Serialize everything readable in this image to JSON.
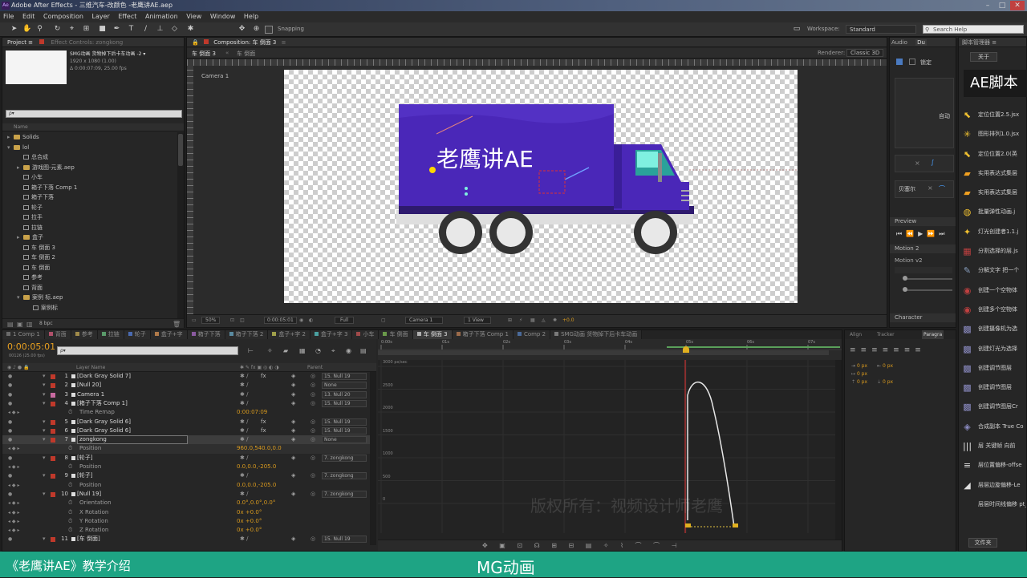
{
  "window": {
    "title": "Adobe After Effects - 三维汽车-改颜色 -老鹰讲AE.aep",
    "min": "–",
    "max": "□",
    "close": "✕"
  },
  "menu": [
    "File",
    "Edit",
    "Composition",
    "Layer",
    "Effect",
    "Animation",
    "View",
    "Window",
    "Help"
  ],
  "toolbar": {
    "snapping": "Snapping",
    "workspace_label": "Workspace:",
    "workspace_value": "Standard",
    "search_placeholder": "Search Help"
  },
  "project": {
    "tab_project": "Project ≡",
    "tab_effect": "Effect Controls: zongkong",
    "comp_name": "SMG动画 货物掉下后卡车动画 -2 ▾",
    "comp_size": "1920 x 1080 (1.00)",
    "comp_duration": "Δ 0:00:07:09, 25.00 fps",
    "search_placeholder": "ρ▾",
    "col_name": "Name",
    "items": [
      {
        "t": "folder",
        "n": "Solids",
        "d": 0,
        "arrow": "▸"
      },
      {
        "t": "folder",
        "n": "lol",
        "d": 0,
        "arrow": "▾"
      },
      {
        "t": "comp",
        "n": "总合成",
        "d": 1,
        "arrow": ""
      },
      {
        "t": "folder",
        "n": "游戏图-元素.aep",
        "d": 1,
        "arrow": "▸"
      },
      {
        "t": "comp",
        "n": "小车",
        "d": 1,
        "arrow": ""
      },
      {
        "t": "comp",
        "n": "箱子下落 Comp 1",
        "d": 1,
        "arrow": ""
      },
      {
        "t": "comp",
        "n": "箱子下落",
        "d": 1,
        "arrow": ""
      },
      {
        "t": "comp",
        "n": "轮子",
        "d": 1,
        "arrow": ""
      },
      {
        "t": "comp",
        "n": "拉手",
        "d": 1,
        "arrow": ""
      },
      {
        "t": "comp",
        "n": "拉链",
        "d": 1,
        "arrow": ""
      },
      {
        "t": "folder",
        "n": "盒子",
        "d": 1,
        "arrow": "▸"
      },
      {
        "t": "comp",
        "n": "车 倒面 3",
        "d": 1,
        "arrow": ""
      },
      {
        "t": "comp",
        "n": "车 倒面 2",
        "d": 1,
        "arrow": ""
      },
      {
        "t": "comp",
        "n": "车 倒面",
        "d": 1,
        "arrow": ""
      },
      {
        "t": "comp",
        "n": "参考",
        "d": 1,
        "arrow": ""
      },
      {
        "t": "comp",
        "n": "背面",
        "d": 1,
        "arrow": ""
      },
      {
        "t": "folder",
        "n": "案例 标.aep",
        "d": 1,
        "arrow": "▾"
      },
      {
        "t": "comp",
        "n": "案例标",
        "d": 2,
        "arrow": ""
      }
    ],
    "bpc": "8 bpc"
  },
  "composition": {
    "tab": "Composition: 车 倒面 3",
    "subtabs": [
      "车 倒面 3",
      "车 倒面"
    ],
    "renderer_label": "Renderer:",
    "renderer_value": "Classic 3D",
    "camera_label": "Camera 1",
    "truck_text": "老鹰讲AE",
    "footer": {
      "zoom": "50%",
      "time": "0:00:05:01",
      "res": "Full",
      "view": "Camera 1",
      "views": "1 View",
      "exposure": "+0.0"
    }
  },
  "timeline": {
    "tabs": [
      {
        "label": "1 Comp 1",
        "active": false,
        "color": "#6a6a6a"
      },
      {
        "label": "背面",
        "active": false,
        "color": "#b0506a"
      },
      {
        "label": "参考",
        "active": false,
        "color": "#a08a4a"
      },
      {
        "label": "拉链",
        "active": false,
        "color": "#5a9a6a"
      },
      {
        "label": "轮子",
        "active": false,
        "color": "#4a6ab0"
      },
      {
        "label": "盒子+字",
        "active": false,
        "color": "#b07a4a"
      },
      {
        "label": "箱子下落",
        "active": false,
        "color": "#8a5aa0"
      },
      {
        "label": "箱子下落 2",
        "active": false,
        "color": "#5a8aa0"
      },
      {
        "label": "盒子+字 2",
        "active": false,
        "color": "#a0a04a"
      },
      {
        "label": "盒子+字 3",
        "active": false,
        "color": "#4aa0a0"
      },
      {
        "label": "小车",
        "active": false,
        "color": "#a04a4a"
      },
      {
        "label": "车 倒面",
        "active": false,
        "color": "#6a9a4a"
      },
      {
        "label": "车 倒面 3",
        "active": true,
        "color": "#b0b0b0"
      },
      {
        "label": "箱子下落 Comp 1",
        "active": false,
        "color": "#9a6a4a"
      },
      {
        "label": "Comp 2",
        "active": false,
        "color": "#4a6a9a"
      },
      {
        "label": "SMG动画 货物掉下后卡车动画",
        "active": false,
        "color": "#7a7a7a"
      }
    ],
    "timecode": "0:00:05:01",
    "timecode_sub": "00126 (25.00 fps)",
    "search_placeholder": "ρ▾",
    "col_layer": "Layer Name",
    "col_parent": "Parent",
    "layers": [
      {
        "num": "1",
        "name": "[Dark Gray Solid 7]",
        "color": "#c0392b",
        "parent": "15. Null 19",
        "type": "layer",
        "sw": "fx"
      },
      {
        "num": "2",
        "name": "[Null 20]",
        "color": "#c0392b",
        "parent": "None",
        "type": "layer",
        "sw": ""
      },
      {
        "num": "3",
        "name": "Camera 1",
        "color": "#c86aa0",
        "parent": "13. Null 20",
        "type": "layer",
        "sw": ""
      },
      {
        "num": "4",
        "name": "[箱子下落 Comp 1]",
        "color": "#c0392b",
        "parent": "15. Null 19",
        "type": "layer",
        "sw": ""
      },
      {
        "num": "",
        "name": "Time Remap",
        "color": "",
        "val": "0:00:07:09",
        "type": "prop"
      },
      {
        "num": "5",
        "name": "[Dark Gray Solid 6]",
        "color": "#c0392b",
        "parent": "15. Null 19",
        "type": "layer",
        "sw": "fx"
      },
      {
        "num": "6",
        "name": "[Dark Gray Solid 6]",
        "color": "#c0392b",
        "parent": "15. Null 19",
        "type": "layer",
        "sw": "fx"
      },
      {
        "num": "7",
        "name": "zongkong",
        "color": "#c0392b",
        "parent": "None",
        "type": "layer",
        "sw": "",
        "selected": true
      },
      {
        "num": "",
        "name": "Position",
        "color": "",
        "val": "960.0,540.0,0.0",
        "type": "prop",
        "hl": true
      },
      {
        "num": "8",
        "name": "[轮子]",
        "color": "#c0392b",
        "parent": "7. zongkong",
        "type": "layer",
        "sw": ""
      },
      {
        "num": "",
        "name": "Position",
        "color": "",
        "val": "0.0,0.0,-205.0",
        "type": "prop"
      },
      {
        "num": "9",
        "name": "[轮子]",
        "color": "#c0392b",
        "parent": "7. zongkong",
        "type": "layer",
        "sw": ""
      },
      {
        "num": "",
        "name": "Position",
        "color": "",
        "val": "0.0,0.0,-205.0",
        "type": "prop"
      },
      {
        "num": "10",
        "name": "[Null 19]",
        "color": "#c0392b",
        "parent": "7. zongkong",
        "type": "layer",
        "sw": ""
      },
      {
        "num": "",
        "name": "Orientation",
        "color": "",
        "val": "0.0°,0.0°,0.0°",
        "type": "prop"
      },
      {
        "num": "",
        "name": "X Rotation",
        "color": "",
        "val": "0x +0.0°",
        "type": "prop"
      },
      {
        "num": "",
        "name": "Y Rotation",
        "color": "",
        "val": "0x +0.0°",
        "type": "prop"
      },
      {
        "num": "",
        "name": "Z Rotation",
        "color": "",
        "val": "0x +0.0°",
        "type": "prop"
      },
      {
        "num": "11",
        "name": "[车 倒面]",
        "color": "#c0392b",
        "parent": "15. Null 19",
        "type": "layer",
        "sw": ""
      }
    ],
    "ruler": [
      "0:00s",
      "01s",
      "02s",
      "03s",
      "04s",
      "05s",
      "06s",
      "07s"
    ],
    "graph_labels": [
      "3000 px/sec",
      "2500",
      "2000",
      "1500",
      "1000",
      "500",
      "0"
    ],
    "watermark": "版权所有：视频设计师老鹰"
  },
  "right": {
    "tabs1": [
      "Audio",
      "Du"
    ],
    "align_label": "锁定",
    "auto_label": "自动",
    "bezier_label": "贝塞尔",
    "preview_tab": "Preview",
    "motion2_tab": "Motion 2",
    "motion_v2": "Motion v2",
    "character_tab": "Character",
    "align_tabs": [
      "Align",
      "Tracker",
      "Paragra"
    ],
    "para_values": [
      "0 px",
      "0 px",
      "0 px",
      "0 px",
      "0 px"
    ]
  },
  "scripts": {
    "tab": "脚本管理器 ≡",
    "close_btn": "关于",
    "banner": "AE脚本",
    "items": [
      {
        "i": "⬉",
        "c": "#f0c030",
        "n": "定位位置2.5.jsx"
      },
      {
        "i": "✳",
        "c": "#f0c030",
        "n": "图形排列1.0.jsx"
      },
      {
        "i": "⬉",
        "c": "#f0c030",
        "n": "定位位置2.0(英"
      },
      {
        "i": "▰",
        "c": "#f0a020",
        "n": "实用表达式集层"
      },
      {
        "i": "▰",
        "c": "#f0a020",
        "n": "实用表达式集层"
      },
      {
        "i": "◍",
        "c": "#f0c030",
        "n": "批量弹性动画.j"
      },
      {
        "i": "✦",
        "c": "#f0c030",
        "n": "灯光创建者1.1.j"
      },
      {
        "i": "▦",
        "c": "#c04040",
        "n": "分割选择的层.js"
      },
      {
        "i": "✎",
        "c": "#8aa0c0",
        "n": "分解文字 把一个"
      },
      {
        "i": "◉",
        "c": "#c04040",
        "n": "创建一个空物体"
      },
      {
        "i": "◉",
        "c": "#c04040",
        "n": "创建多个空物体"
      },
      {
        "i": "▩",
        "c": "#8a8ac0",
        "n": "创建摄像机为选"
      },
      {
        "i": "▩",
        "c": "#8a8ac0",
        "n": "创建灯光为选择"
      },
      {
        "i": "▩",
        "c": "#8a8ac0",
        "n": "创建调节图层"
      },
      {
        "i": "▩",
        "c": "#8a8ac0",
        "n": "创建调节图层"
      },
      {
        "i": "▩",
        "c": "#8a8ac0",
        "n": "创建调节图层Cr"
      },
      {
        "i": "◈",
        "c": "#8a8ac0",
        "n": "合成副本 True Co"
      },
      {
        "i": "|||",
        "c": "#e0e0e0",
        "n": "层 关键帧 向前"
      },
      {
        "i": "≡",
        "c": "#e0e0e0",
        "n": "层位置偏移-offse"
      },
      {
        "i": "◢",
        "c": "#e0e0e0",
        "n": "层层边旋偏移-Le"
      },
      {
        "i": "",
        "c": "#e0e0e0",
        "n": "层层时间线偏移 pt_Sh"
      }
    ],
    "footer_btn": "文件夹"
  },
  "bottom": {
    "left": "《老鹰讲AE》教学介绍",
    "center": "MG动画"
  }
}
